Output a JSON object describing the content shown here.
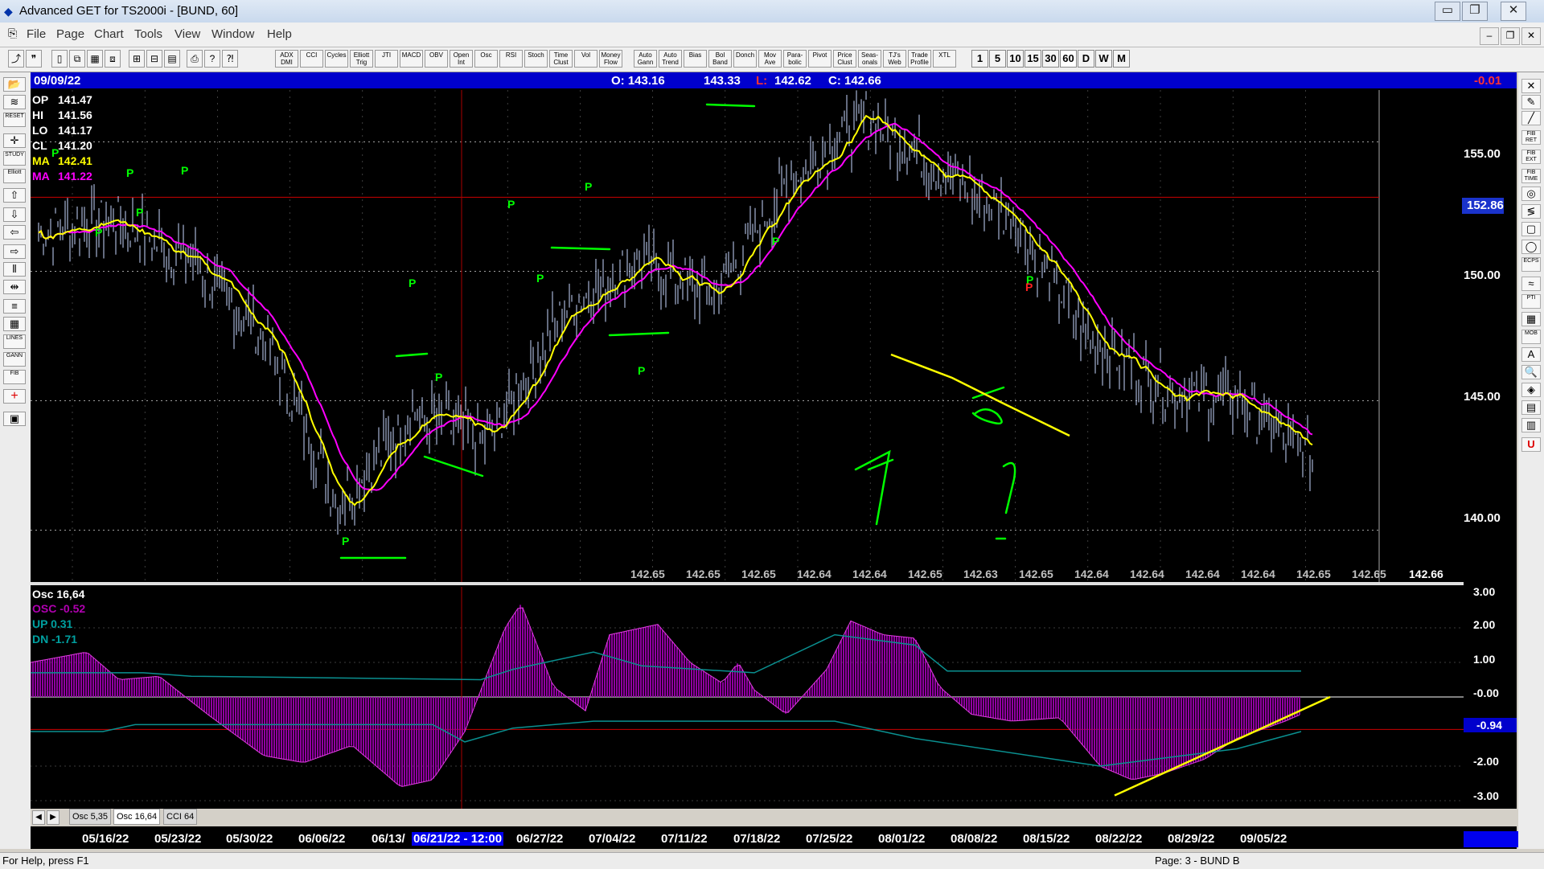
{
  "window": {
    "title": "Advanced GET for TS2000i - [BUND, 60]",
    "controls": {
      "minimize": "▭",
      "restore": "❐",
      "close": "✕"
    }
  },
  "menu": [
    "File",
    "Page",
    "Chart",
    "Tools",
    "View",
    "Window",
    "Help"
  ],
  "toolbar": {
    "studies": [
      "ADX DMI",
      "CCI",
      "Cycles",
      "Elliott Trig",
      "JTI",
      "MACD",
      "OBV",
      "Open Int",
      "Osc",
      "RSI",
      "Stoch",
      "Time Clust",
      "Vol",
      "Money Flow",
      "Auto Gann",
      "Auto Trend",
      "Bias",
      "Bol Band",
      "Donch",
      "Mov Ave",
      "Para-bolic",
      "Pivot",
      "Price Clust",
      "Seas-onals",
      "TJ's Web",
      "Trade Profile",
      "XTL"
    ],
    "timeframes": [
      "1",
      "5",
      "10",
      "15",
      "30",
      "60",
      "D",
      "W",
      "M"
    ]
  },
  "info_bar": {
    "date": "09/09/22",
    "open": "O: 143.16",
    "high": "143.33",
    "low_label": "L:",
    "low": "142.62",
    "close": "C: 142.66",
    "change": "-0.01"
  },
  "ohlc_readout": [
    {
      "label": "OP",
      "value": "141.47",
      "color": "#ffffff"
    },
    {
      "label": "HI",
      "value": "141.56",
      "color": "#ffffff"
    },
    {
      "label": "LO",
      "value": "141.17",
      "color": "#ffffff"
    },
    {
      "label": "CL",
      "value": "141.20",
      "color": "#ffffff"
    },
    {
      "label": "MA",
      "value": "142.41",
      "color": "#ffff00"
    },
    {
      "label": "MA",
      "value": "141.22",
      "color": "#ff00ff"
    }
  ],
  "price_axis": [
    "155.00",
    "152.86",
    "150.00",
    "145.00",
    "140.00"
  ],
  "cursor_values": [
    "142.65",
    "142.65",
    "142.65",
    "142.64",
    "142.64",
    "142.65",
    "142.63",
    "142.65",
    "142.64",
    "142.64",
    "142.64",
    "142.64",
    "142.65",
    "142.65",
    "142.66"
  ],
  "pivot_label": "P",
  "oscillator": {
    "title": "Osc 16,64",
    "osc": "OSC -0.52",
    "up": "UP  0.31",
    "dn": "DN  -1.71",
    "axis": [
      "3.00",
      "2.00",
      "1.00",
      "-0.00",
      "-0.94",
      "-2.00",
      "-3.00"
    ],
    "current": "-0.94"
  },
  "tabs": [
    "Osc 5,35",
    "Osc 16,64",
    "CCI 64"
  ],
  "dates": [
    "05/16/22",
    "05/23/22",
    "05/30/22",
    "06/06/22",
    "06/13/",
    "06/21/22 - 12:00",
    "06/27/22",
    "07/04/22",
    "07/11/22",
    "07/18/22",
    "07/25/22",
    "08/01/22",
    "08/08/22",
    "08/15/22",
    "08/22/22",
    "08/29/22",
    "09/05/22"
  ],
  "status": {
    "help": "For Help, press F1",
    "page": "Page: 3 - BUND B"
  },
  "colors": {
    "background": "#000000",
    "info_bar": "#0000cc",
    "price_line": "#c8d8ff",
    "ma_fast": "#ffff00",
    "ma_slow": "#ff00ff",
    "annotation": "#00ff00",
    "histogram": "#9000a0",
    "crosshair": "#cc0000"
  },
  "chart_data": {
    "type": "line",
    "title": "",
    "x": [
      "05/16/22",
      "05/23/22",
      "05/30/22",
      "06/06/22",
      "06/13/22",
      "06/21/22",
      "06/27/22",
      "07/04/22",
      "07/11/22",
      "07/18/22",
      "07/25/22",
      "08/01/22",
      "08/08/22",
      "08/15/22",
      "08/22/22",
      "08/29/22",
      "09/05/22",
      "09/09/22"
    ],
    "series": [
      {
        "name": "",
        "values": [
          151.5,
          152.0,
          150.5,
          147.5,
          141.0,
          144.5,
          143.5,
          148.5,
          150.5,
          149.0,
          153.5,
          156.0,
          154.0,
          152.0,
          147.5,
          145.5,
          145.0,
          142.66
        ]
      }
    ],
    "ylim": [
      138,
      157
    ],
    "grid": true,
    "hline": 152.86
  }
}
